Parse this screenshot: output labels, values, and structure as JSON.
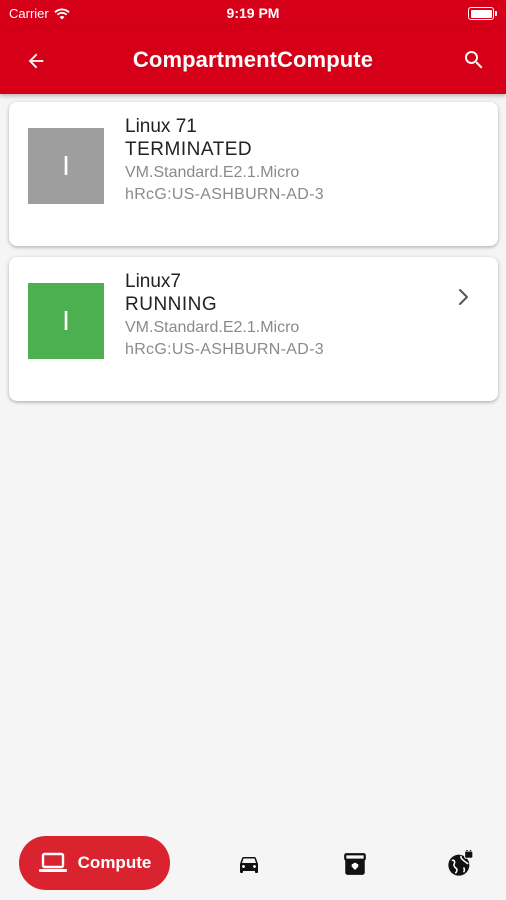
{
  "status_bar": {
    "carrier": "Carrier",
    "time": "9:19 PM",
    "wifi_icon": "wifi-icon",
    "battery_icon": "battery-icon"
  },
  "app_bar": {
    "title": "CompartmentCompute",
    "back_icon": "arrow-back-icon",
    "search_icon": "search-icon",
    "color": "#d50017"
  },
  "instances": [
    {
      "initial": "I",
      "name": "Linux 71",
      "state": "TERMINATED",
      "shape": "VM.Standard.E2.1.Micro",
      "availability_domain": "hRcG:US-ASHBURN-AD-3",
      "thumb_color": "#9e9e9e",
      "has_chevron": false
    },
    {
      "initial": "I",
      "name": "Linux7",
      "state": "RUNNING",
      "shape": "VM.Standard.E2.1.Micro",
      "availability_domain": "hRcG:US-ASHBURN-AD-3",
      "thumb_color": "#4caf50",
      "has_chevron": true
    }
  ],
  "bottom_nav": {
    "active_label": "Compute",
    "active_icon": "laptop-icon",
    "items": [
      "car-icon",
      "archive-icon",
      "globe-network-icon"
    ],
    "active_color": "#d9232e"
  }
}
